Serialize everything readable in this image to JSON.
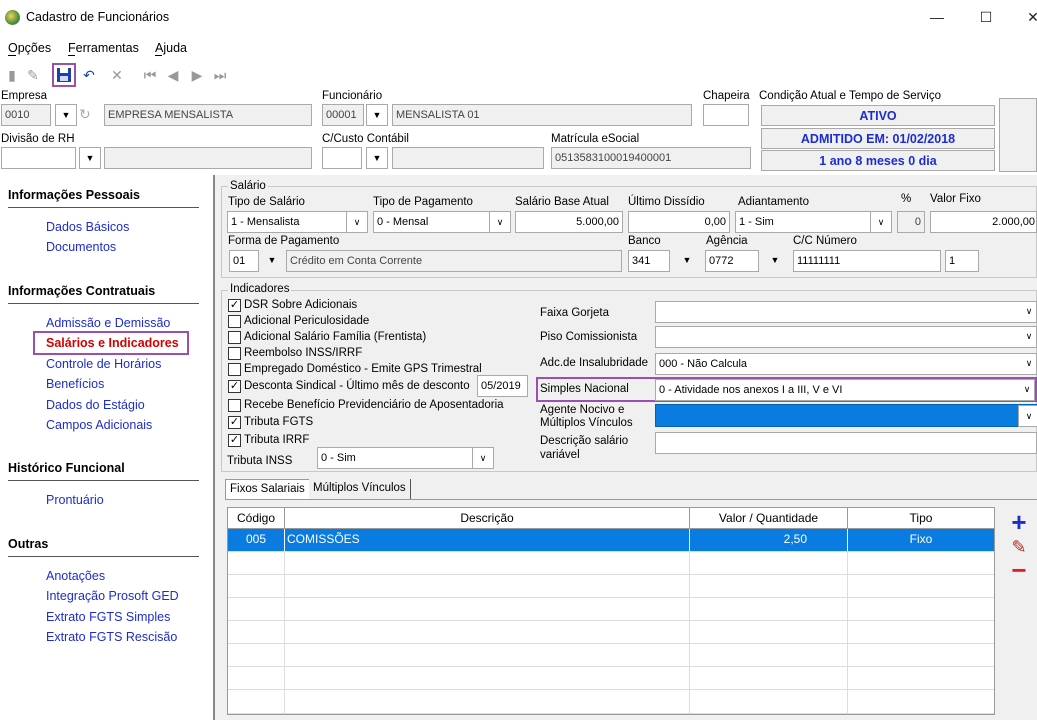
{
  "window": {
    "title": "Cadastro de Funcionários",
    "minimize": "—",
    "maximize": "☐",
    "close": "✕"
  },
  "menu": {
    "opcoes": "Opções",
    "ferramentas": "Ferramentas",
    "ajuda": "Ajuda"
  },
  "top": {
    "empresa_label": "Empresa",
    "empresa_code": "0010",
    "empresa_name": "EMPRESA MENSALISTA",
    "funcionario_label": "Funcionário",
    "funcionario_code": "00001",
    "funcionario_name": "MENSALISTA 01",
    "chapeira_label": "Chapeira",
    "chapeira_value": "",
    "condicao_label": "Condição Atual e Tempo de Serviço",
    "status1": "ATIVO",
    "status2": "ADMITIDO EM: 01/02/2018",
    "status3": "1 ano 8 meses 0 dia",
    "divisao_label": "Divisão de RH",
    "ccusto_label": "C/Custo Contábil",
    "matricula_label": "Matrícula eSocial",
    "matricula_value": "051358310001940000​1"
  },
  "nav": {
    "sec1": "Informações Pessoais",
    "dados_basicos": "Dados Básicos",
    "documentos": "Documentos",
    "sec2": "Informações Contratuais",
    "admissao": "Admissão e Demissão",
    "salarios": "Salários e Indicadores",
    "controle": "Controle de Horários",
    "beneficios": "Benefícios",
    "estagio": "Dados do Estágio",
    "campos": "Campos Adicionais",
    "sec3": "Histórico Funcional",
    "prontuario": "Prontuário",
    "sec4": "Outras",
    "anotacoes": "Anotações",
    "integracao": "Integração Prosoft GED",
    "extrato_simples": "Extrato FGTS Simples",
    "extrato_rescisao": "Extrato FGTS Rescisão"
  },
  "salario": {
    "group": "Salário",
    "tipo_salario_label": "Tipo de Salário",
    "tipo_salario": "1 - Mensalista",
    "tipo_pagamento_label": "Tipo de Pagamento",
    "tipo_pagamento": "0 - Mensal",
    "base_label": "Salário Base Atual",
    "base": "5.000,00",
    "dissidio_label": "Último Dissídio",
    "dissidio": "0,00",
    "adiantamento_label": "Adiantamento",
    "adiantamento": "1 - Sim",
    "pct_label": "%",
    "pct": "0",
    "valor_fixo_label": "Valor Fixo",
    "valor_fixo": "2.000,00",
    "forma_label": "Forma de Pagamento",
    "forma_code": "01",
    "forma": "Crédito em Conta Corrente",
    "banco_label": "Banco",
    "banco": "341",
    "agencia_label": "Agência",
    "agencia": "0772",
    "cc_label": "C/C Número",
    "cc": "11111111",
    "cc_dv": "1"
  },
  "indicadores": {
    "group": "Indicadores",
    "checks": [
      {
        "label": "DSR Sobre Adicionais",
        "checked": "✓"
      },
      {
        "label": "Adicional Periculosidade",
        "checked": ""
      },
      {
        "label": "Adicional Salário Família (Frentista)",
        "checked": ""
      },
      {
        "label": "Reembolso INSS/IRRF",
        "checked": ""
      },
      {
        "label": "Empregado Doméstico - Emite GPS Trimestral",
        "checked": ""
      },
      {
        "label": "Desconta Sindical - Último mês de desconto",
        "checked": "✓"
      },
      {
        "label": "Recebe Benefício Previdenciário de Aposentadoria",
        "checked": ""
      },
      {
        "label": "Tributa FGTS",
        "checked": "✓"
      },
      {
        "label": "Tributa IRRF",
        "checked": "✓"
      }
    ],
    "sindical_mes": "05/2019",
    "tributa_inss_label": "Tributa INSS",
    "tributa_inss": "0 - Sim",
    "faixa_label": "Faixa Gorjeta",
    "faixa": "",
    "piso_label": "Piso Comissionista",
    "piso": "",
    "insalubridade_label": "Adc.de Insalubridade",
    "insalubridade": "000 - Não Calcula",
    "simples_label": "Simples Nacional",
    "simples": "0 - Atividade nos anexos I a III, V e VI",
    "agente_label1": "Agente Nocivo e",
    "agente_label2": "Múltiplos Vínculos",
    "agente": "",
    "descricao_label1": "Descrição salário",
    "descricao_label2": "variável",
    "descricao": ""
  },
  "tabs": {
    "fixos": "Fixos Salariais",
    "multiplos": "Múltiplos Vínculos"
  },
  "grid": {
    "headers": {
      "codigo": "Código",
      "descricao": "Descrição",
      "valor": "Valor / Quantidade",
      "tipo": "Tipo"
    },
    "rows": [
      {
        "codigo": "005",
        "descricao": "COMISSÕES",
        "valor": "2,50",
        "tipo": "Fixo"
      }
    ]
  },
  "actions": {
    "add": "+",
    "edit": "✎",
    "remove": "−"
  }
}
